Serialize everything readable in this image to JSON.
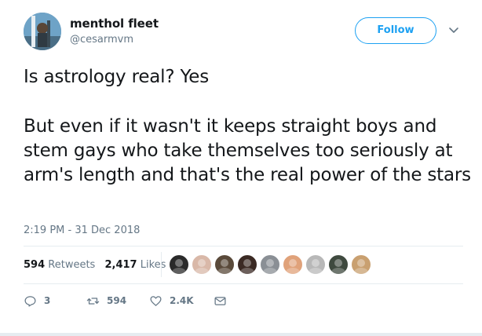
{
  "user": {
    "display_name": "menthol fleet",
    "handle": "@cesarmvm",
    "follow_label": "Follow"
  },
  "tweet": {
    "paragraph_1": "Is astrology real? Yes",
    "paragraph_2": "But even if it wasn't it keeps straight boys and stem gays who take themselves too seriously at arm's length and that's the real power of the stars",
    "timestamp": "2:19 PM - 31 Dec 2018"
  },
  "stats": {
    "retweets_count": "594",
    "retweets_label": "Retweets",
    "likes_count": "2,417",
    "likes_label": "Likes"
  },
  "likers": [
    {
      "icon": "avatar",
      "color": "#2a2a2a"
    },
    {
      "icon": "avatar",
      "color": "#d9b8a8"
    },
    {
      "icon": "avatar",
      "color": "#5a4a3a"
    },
    {
      "icon": "avatar",
      "color": "#3b2a24"
    },
    {
      "icon": "avatar",
      "color": "#8a8f95"
    },
    {
      "icon": "avatar",
      "color": "#e0a27a"
    },
    {
      "icon": "avatar",
      "color": "#b8b8b8"
    },
    {
      "icon": "avatar",
      "color": "#3f4a3f"
    },
    {
      "icon": "avatar",
      "color": "#c9a070"
    }
  ],
  "actions": {
    "reply_count": "3",
    "retweet_count": "594",
    "like_count": "2.4K"
  },
  "colors": {
    "accent": "#1da1f2",
    "text": "#14171a",
    "secondary": "#657786",
    "border": "#e6ecf0"
  }
}
